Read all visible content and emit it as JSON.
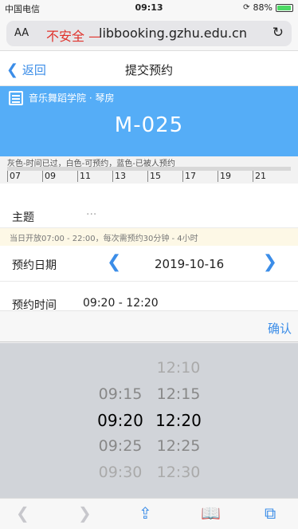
{
  "status": {
    "carrier": "中国电信",
    "time": "09:13",
    "battery": "88%"
  },
  "browser": {
    "aa": "AA",
    "insecure": "不安全 —",
    "domain": "libbooking.gzhu.edu.cn"
  },
  "nav": {
    "back": "返回",
    "title": "提交预约"
  },
  "banner": {
    "location": "音乐舞蹈学院 · 琴房",
    "room": "M-025"
  },
  "timeline": {
    "legend": "灰色-时间已过，白色-可预约，蓝色-已被人预约",
    "hours": [
      "07",
      "09",
      "11",
      "13",
      "15",
      "17",
      "19",
      "21"
    ]
  },
  "form": {
    "subject_label": "主题",
    "subject_value": "···",
    "note": "当日开放07:00 - 22:00，每次需预约30分钟 - 4小时",
    "date_label": "预约日期",
    "date_value": "2019-10-16",
    "time_label": "预约时间",
    "time_value": "09:20 - 12:20"
  },
  "confirm": "确认",
  "picker": {
    "start": [
      "",
      "09:15",
      "09:20",
      "09:25",
      "09:30"
    ],
    "end": [
      "12:10",
      "12:15",
      "12:20",
      "12:25",
      "12:30"
    ]
  }
}
